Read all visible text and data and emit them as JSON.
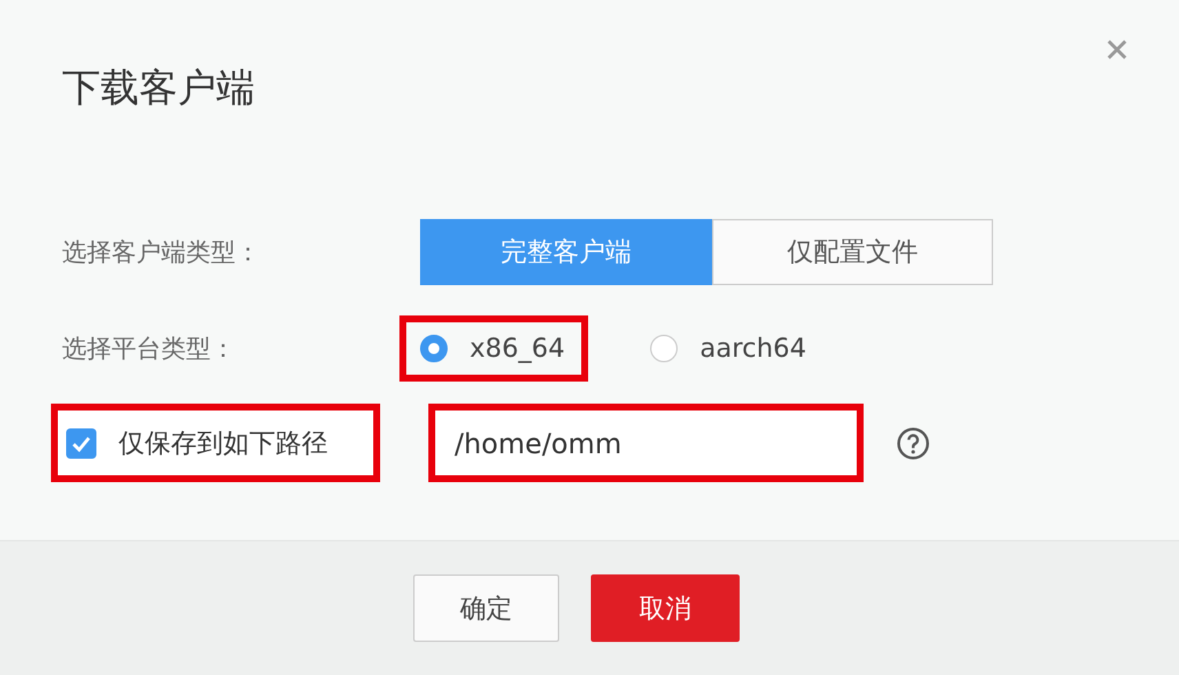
{
  "dialog": {
    "title": "下载客户端",
    "fields": [
      {
        "kind": "segmented",
        "label": "选择客户端类型：",
        "options": [
          {
            "label": "完整客户端",
            "selected": true
          },
          {
            "label": "仅配置文件",
            "selected": false
          }
        ]
      },
      {
        "kind": "radio",
        "label": "选择平台类型：",
        "options": [
          {
            "label": "x86_64",
            "selected": true,
            "highlighted": true
          },
          {
            "label": "aarch64",
            "selected": false,
            "highlighted": false
          }
        ]
      },
      {
        "kind": "path",
        "checkbox": {
          "label": "仅保存到如下路径",
          "checked": true,
          "highlighted": true
        },
        "path": {
          "value": "/home/omm",
          "highlighted": true
        }
      }
    ],
    "buttons": [
      {
        "label": "确定",
        "kind": "default"
      },
      {
        "label": "取消",
        "kind": "primary"
      }
    ]
  }
}
